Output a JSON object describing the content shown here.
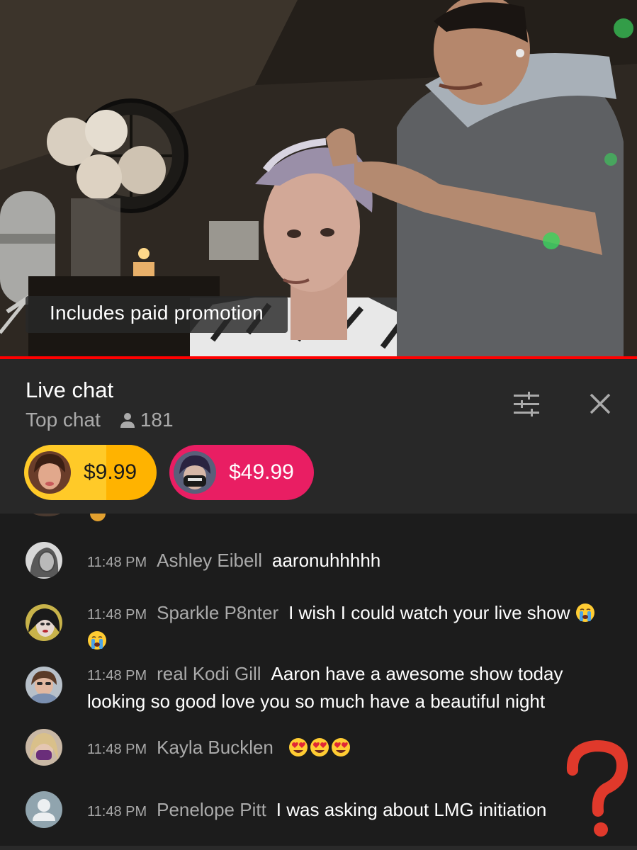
{
  "video": {
    "promo_badge": "Includes paid promotion",
    "progress_color": "#ff0000"
  },
  "chat_header": {
    "title": "Live chat",
    "mode": "Top chat",
    "viewer_count": "181",
    "icons": [
      "person-icon",
      "filter-icon",
      "close-icon"
    ]
  },
  "tickers": [
    {
      "amount": "$9.99",
      "color": "#ffca28"
    },
    {
      "amount": "$49.99",
      "color": "#e91e63"
    }
  ],
  "messages": [
    {
      "time": "11:48 PM",
      "author": "Ashley Eibell",
      "text": "aaronuhhhhh"
    },
    {
      "time": "11:48 PM",
      "author": "Sparkle P8nter",
      "text": "I wish I could watch your live show",
      "emoji": [
        "crying-face",
        "crying-face"
      ]
    },
    {
      "time": "11:48 PM",
      "author": "real Kodi Gill",
      "text": "Aaron have a awesome show today looking so good love you so much have a beautiful night"
    },
    {
      "time": "11:48 PM",
      "author": "Kayla Bucklen",
      "text": "",
      "emoji": [
        "heart-eyes",
        "heart-eyes",
        "heart-eyes"
      ]
    },
    {
      "time": "11:48 PM",
      "author": "Penelope Pitt",
      "text": "I was asking about LMG initiation"
    }
  ],
  "colors": {
    "header_bg": "#282828",
    "chat_bg": "#1c1c1c",
    "secondary_text": "#aaaaaa",
    "annotation": "#e0392b"
  }
}
